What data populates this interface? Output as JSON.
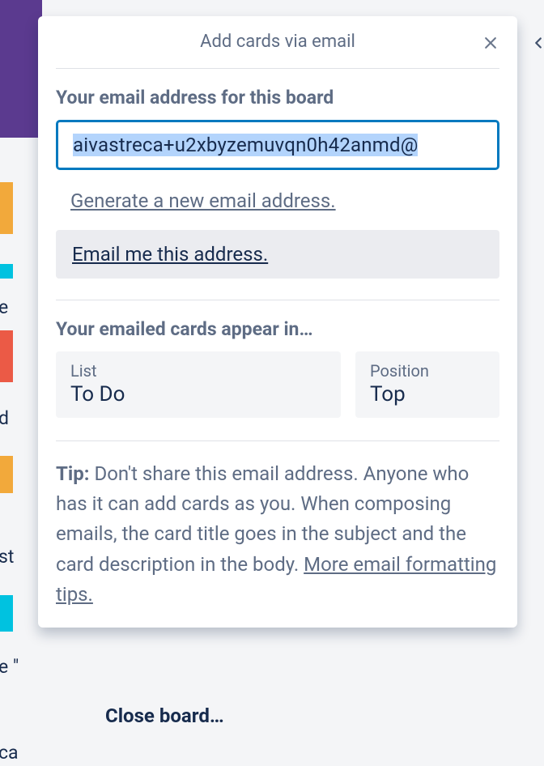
{
  "background": {
    "text1": "e",
    "text2": "d",
    "text3": "st",
    "text4": "e \"",
    "text5": "ca"
  },
  "popover": {
    "title": "Add cards via email",
    "email_label": "Your email address for this board",
    "email_value": "aivastreca+u2xbyzemuvqn0h42anmd@",
    "generate_link": "Generate a new email address.",
    "email_me_link": "Email me this address.",
    "appear_label": "Your emailed cards appear in…",
    "list": {
      "label": "List",
      "value": "To Do"
    },
    "position": {
      "label": "Position",
      "value": "Top"
    },
    "tip": {
      "prefix": "Tip:",
      "body": " Don't share this email address. Anyone who has it can add cards as you. When composing emails, the card title goes in the subject and the card description in the body. ",
      "link": "More email formatting tips."
    }
  },
  "close_board": "Close board…"
}
